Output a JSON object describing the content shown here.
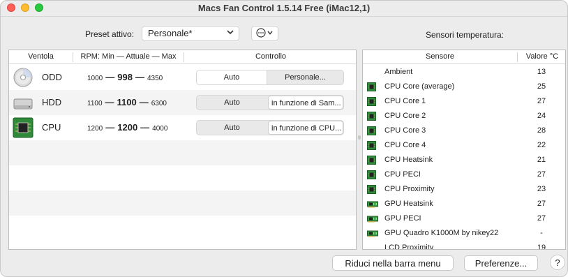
{
  "window": {
    "title": "Macs Fan Control 1.5.14 Free (iMac12,1)"
  },
  "toolbar": {
    "preset_label": "Preset attivo:",
    "preset_value": "Personale*",
    "more_label": "⋯",
    "sensors_label": "Sensori temperatura:"
  },
  "fans": {
    "headers": {
      "fan": "Ventola",
      "rpm": "RPM: Min — Attuale — Max",
      "control": "Controllo"
    },
    "rows": [
      {
        "name": "ODD",
        "icon": "optical-drive-icon",
        "min": "1000",
        "current": "998",
        "max": "4350",
        "auto_label": "Auto",
        "option_label": "Personale..."
      },
      {
        "name": "HDD",
        "icon": "hard-drive-icon",
        "min": "1100",
        "current": "1100",
        "max": "6300",
        "auto_label": "Auto",
        "option_label": "in funzione di Sam..."
      },
      {
        "name": "CPU",
        "icon": "cpu-chip-icon",
        "min": "1200",
        "current": "1200",
        "max": "4000",
        "auto_label": "Auto",
        "option_label": "in funzione di CPU..."
      }
    ]
  },
  "sensors": {
    "headers": {
      "sensor": "Sensore",
      "value": "Valore °C"
    },
    "rows": [
      {
        "name": "Ambient",
        "value": "13",
        "icon": ""
      },
      {
        "name": "CPU Core (average)",
        "value": "25",
        "icon": "cpu-chip-icon"
      },
      {
        "name": "CPU Core 1",
        "value": "27",
        "icon": "cpu-chip-icon"
      },
      {
        "name": "CPU Core 2",
        "value": "24",
        "icon": "cpu-chip-icon"
      },
      {
        "name": "CPU Core 3",
        "value": "28",
        "icon": "cpu-chip-icon"
      },
      {
        "name": "CPU Core 4",
        "value": "22",
        "icon": "cpu-chip-icon"
      },
      {
        "name": "CPU Heatsink",
        "value": "21",
        "icon": "cpu-chip-icon"
      },
      {
        "name": "CPU PECI",
        "value": "27",
        "icon": "cpu-chip-icon"
      },
      {
        "name": "CPU Proximity",
        "value": "23",
        "icon": "cpu-chip-icon"
      },
      {
        "name": "GPU Heatsink",
        "value": "27",
        "icon": "gpu-card-icon"
      },
      {
        "name": "GPU PECI",
        "value": "27",
        "icon": "gpu-card-icon"
      },
      {
        "name": "GPU Quadro K1000M by nikey22",
        "value": "-",
        "icon": "gpu-card-icon"
      },
      {
        "name": "LCD Proximity",
        "value": "19",
        "icon": ""
      }
    ]
  },
  "footer": {
    "minimize_label": "Riduci nella barra menu",
    "prefs_label": "Preferenze...",
    "help_label": "?"
  }
}
